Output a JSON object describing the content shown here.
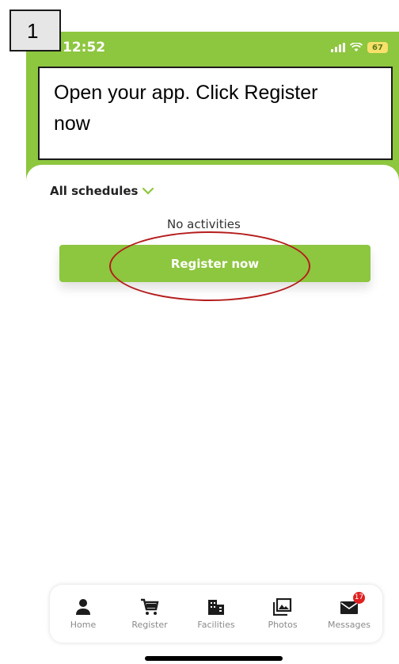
{
  "status_bar": {
    "time": "12:52",
    "battery": "67"
  },
  "step": {
    "number": "1"
  },
  "callout": {
    "line1": "Open your app. Click Register",
    "line2": "now"
  },
  "schedules": {
    "label": "All schedules"
  },
  "empty_state": {
    "text": "No activities"
  },
  "register_button": {
    "label": "Register now"
  },
  "tab_bar": {
    "items": [
      {
        "label": "Home",
        "icon": "person-icon"
      },
      {
        "label": "Register",
        "icon": "cart-icon"
      },
      {
        "label": "Facilities",
        "icon": "building-icon"
      },
      {
        "label": "Photos",
        "icon": "photos-icon"
      },
      {
        "label": "Messages",
        "icon": "mail-icon",
        "badge": "17"
      }
    ]
  },
  "colors": {
    "brand": "#8dc63f",
    "highlight": "#b51c1c",
    "badge": "#e02020"
  }
}
